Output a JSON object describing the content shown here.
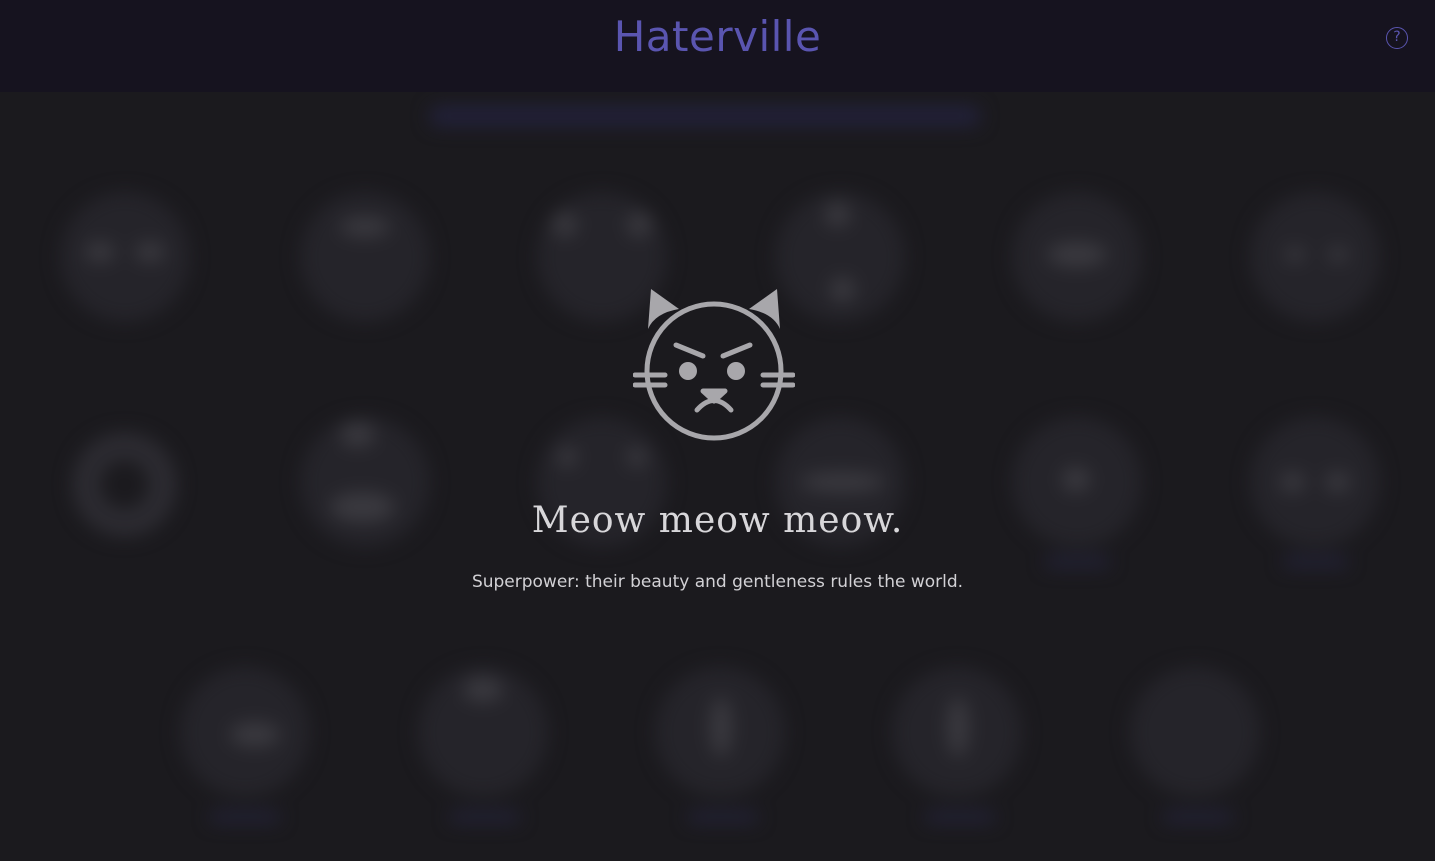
{
  "app": {
    "title": "Haterville",
    "help_label": "?"
  },
  "modal": {
    "icon": "angry-cat-icon",
    "title": "Meow meow meow.",
    "subtitle": "Superpower: their beauty and gentleness rules the world."
  },
  "colors": {
    "header_bg": "#16131f",
    "page_bg": "#1b1a1e",
    "accent": "#5a55b0",
    "icon_gray": "#a8a7ab",
    "text": "#d8d7da"
  }
}
